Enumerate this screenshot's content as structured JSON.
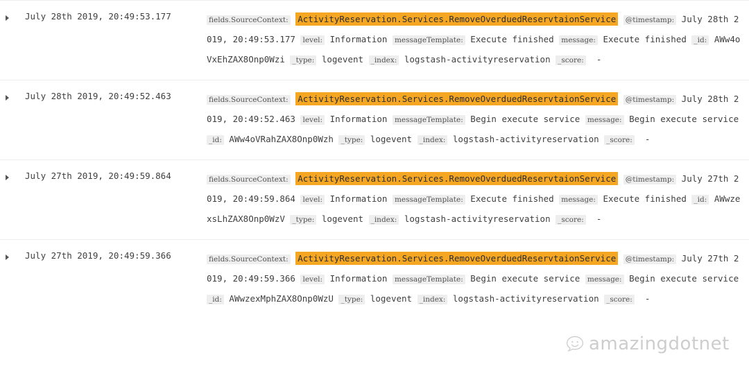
{
  "app": {
    "type": "log-table",
    "highlight_color": "#f5a623",
    "field_label_bg": "#eeeeee",
    "row_divider_color": "#ededed"
  },
  "icons": {
    "expand": "caret-right-icon",
    "watermark": "smiley-speech-bubble-icon"
  },
  "labels": {
    "fields_source_context": "fields.SourceContext:",
    "timestamp": "@timestamp:",
    "level": "level:",
    "message_template": "messageTemplate:",
    "message": "message:",
    "id": "_id:",
    "type": "_type:",
    "index": "_index:",
    "score": "_score:"
  },
  "watermark": {
    "text": "amazingdotnet"
  },
  "rows": [
    {
      "time": "July 28th 2019, 20:49:53.177",
      "source_context": "ActivityReservation.Services.RemoveOverduedReservtaionService",
      "timestamp": "July 28th 2019, 20:49:53.177",
      "level": "Information",
      "message_template": "Execute finished",
      "message": "Execute finished",
      "id": "AWw4oVxEhZAX8Onp0Wzi",
      "type": "logevent",
      "index": "logstash-activityreservation",
      "score": "-"
    },
    {
      "time": "July 28th 2019, 20:49:52.463",
      "source_context": "ActivityReservation.Services.RemoveOverduedReservtaionService",
      "timestamp": "July 28th 2019, 20:49:52.463",
      "level": "Information",
      "message_template": "Begin execute service",
      "message": "Begin execute service",
      "id": "AWw4oVRahZAX8Onp0Wzh",
      "type": "logevent",
      "index": "logstash-activityreservation",
      "score": "-"
    },
    {
      "time": "July 27th 2019, 20:49:59.864",
      "source_context": "ActivityReservation.Services.RemoveOverduedReservtaionService",
      "timestamp": "July 27th 2019, 20:49:59.864",
      "level": "Information",
      "message_template": "Execute finished",
      "message": "Execute finished",
      "id": "AWwzexsLhZAX8Onp0WzV",
      "type": "logevent",
      "index": "logstash-activityreservation",
      "score": "-"
    },
    {
      "time": "July 27th 2019, 20:49:59.366",
      "source_context": "ActivityReservation.Services.RemoveOverduedReservtaionService",
      "timestamp": "July 27th 2019, 20:49:59.366",
      "level": "Information",
      "message_template": "Begin execute service",
      "message": "Begin execute service",
      "id": "AWwzexMphZAX8Onp0WzU",
      "type": "logevent",
      "index": "logstash-activityreservation",
      "score": "-"
    }
  ]
}
